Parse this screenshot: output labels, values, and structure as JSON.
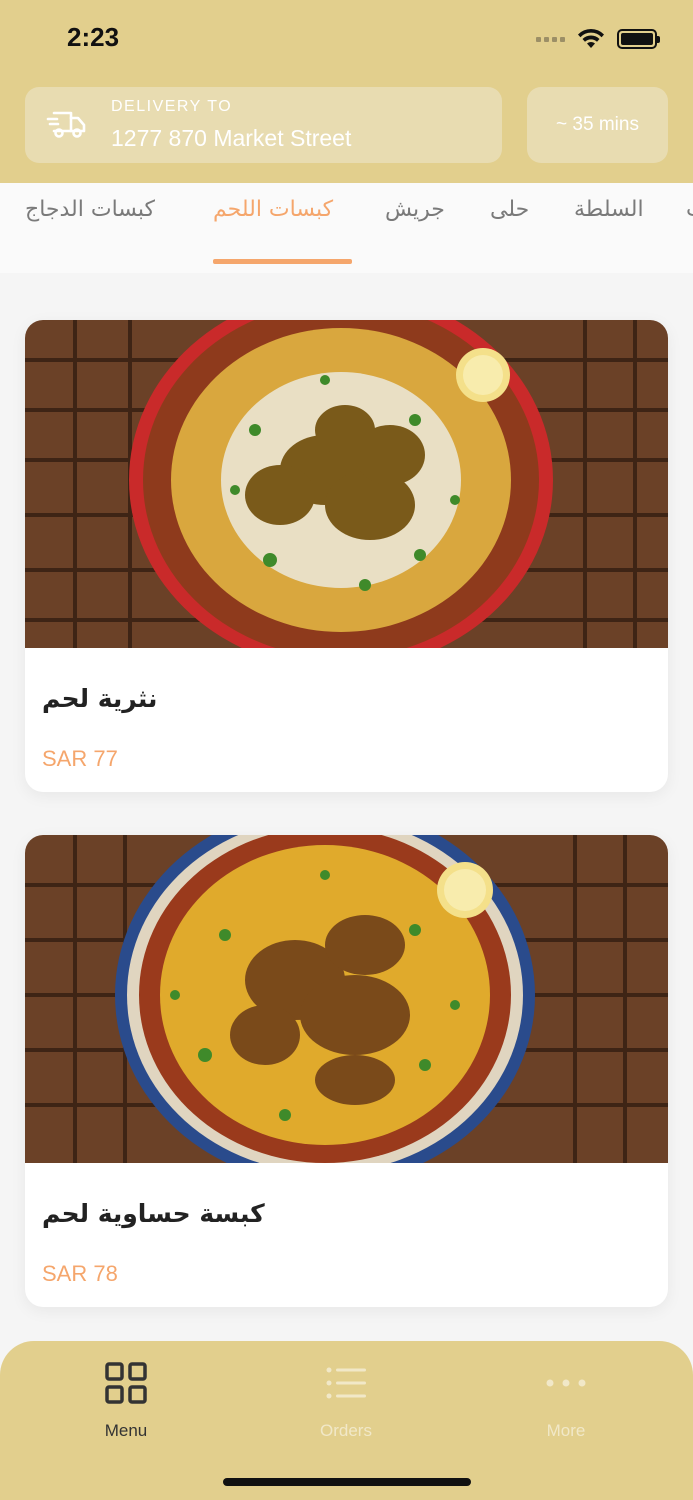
{
  "status_bar": {
    "time": "2:23"
  },
  "header": {
    "delivery_label": "DELIVERY TO",
    "delivery_address": "1277 870 Market Street",
    "eta": "~ 35 mins",
    "icon": "truck-icon"
  },
  "categories": {
    "items": [
      "كبسات الدجاج",
      "كبسات اللحم",
      "جريش",
      "حلى",
      "السلطة"
    ],
    "active_index": 1
  },
  "menu_items": [
    {
      "name": "نثرية لحم",
      "price": "SAR 77"
    },
    {
      "name": "كبسة حساوية لحم",
      "price": "SAR 78"
    }
  ],
  "tabbar": {
    "tabs": [
      {
        "label": "Menu",
        "icon": "grid-icon",
        "active": true
      },
      {
        "label": "Orders",
        "icon": "list-icon",
        "active": false
      },
      {
        "label": "More",
        "icon": "more-dots-icon",
        "active": false
      }
    ]
  },
  "colors": {
    "header_bg": "#e2cf8d",
    "accent": "#f5a66c",
    "box_bg": "#e8dcb1"
  }
}
